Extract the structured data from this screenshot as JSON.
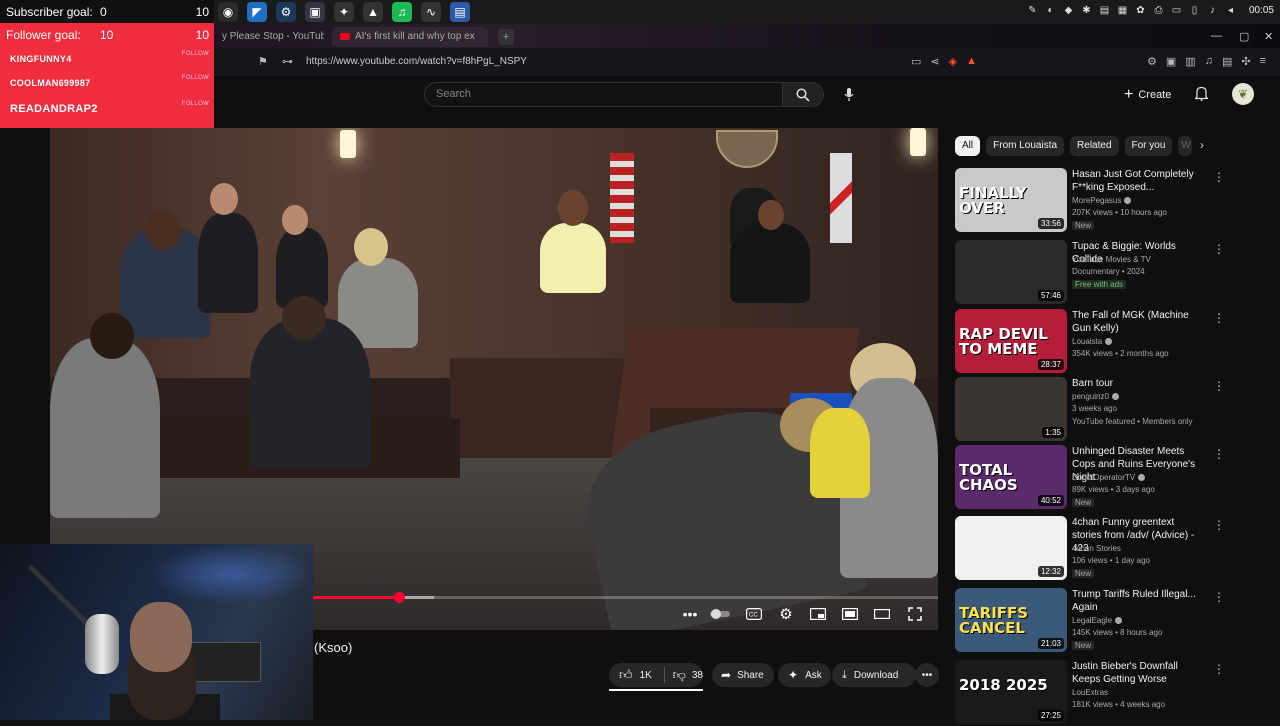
{
  "taskbar": {
    "apps": [
      {
        "icon": "obs-icon",
        "glyph": "◉",
        "color": "#2b2b2b"
      },
      {
        "icon": "vscode-icon",
        "glyph": "◤",
        "color": "#1e6fc4"
      },
      {
        "icon": "steam-icon",
        "glyph": "⚙",
        "color": "#1b3a5a"
      },
      {
        "icon": "remote-desktop-icon",
        "glyph": "▣",
        "color": "#334"
      },
      {
        "icon": "game-controller-icon",
        "glyph": "✦",
        "color": "#333"
      },
      {
        "icon": "upload-icon",
        "glyph": "▲",
        "color": "#333"
      },
      {
        "icon": "spotify-icon",
        "glyph": "♫",
        "color": "#1db954"
      },
      {
        "icon": "monitor-icon",
        "glyph": "∿",
        "color": "#333"
      },
      {
        "icon": "document-icon",
        "glyph": "▤",
        "color": "#2a5aa8"
      }
    ],
    "clock": "00:05"
  },
  "browser": {
    "tabs": [
      {
        "title": "y Please Stop - YouTub"
      },
      {
        "title": "AI's first kill and why top ex"
      }
    ],
    "url": "https://www.youtube.com/watch?v=f8hPgL_NSPY"
  },
  "youtube": {
    "search_placeholder": "Search",
    "create_label": "Create",
    "video_title_fragment": "(Ksoo)",
    "actions": {
      "likes": "1K",
      "dislikes": "38",
      "share": "Share",
      "ask": "Ask",
      "download": "Download"
    },
    "playback": {
      "progress_fraction": 0.393,
      "buffered_fraction": 0.433
    },
    "chips": [
      "All",
      "From Louaista",
      "Related",
      "For you",
      "W"
    ],
    "recommendations": [
      {
        "title": "Hasan Just Got Completely F**king Exposed...",
        "channel": "MorePegasus",
        "verified": true,
        "meta": "207K views • 10 hours ago",
        "badge": "New",
        "extra": "",
        "duration": "33:56",
        "thumb_text": "FINALLY OVER",
        "thumb_color": "#c9c9c9"
      },
      {
        "title": "Tupac & Biggie: Worlds Collide",
        "channel": "YouTube Movies & TV",
        "verified": false,
        "meta": "Documentary • 2024",
        "badge": "",
        "extra": "Free with ads",
        "duration": "57:46",
        "thumb_text": "",
        "thumb_color": "#2a2a2a"
      },
      {
        "title": "The Fall of MGK (Machine Gun Kelly)",
        "channel": "Louaista",
        "verified": true,
        "meta": "354K views • 2 months ago",
        "badge": "",
        "extra": "",
        "duration": "28:37",
        "thumb_text": "RAP DEVIL TO MEME",
        "thumb_color": "#b51e3a"
      },
      {
        "title": "Barn tour",
        "channel": "penguinz0",
        "verified": true,
        "meta": "3 weeks ago",
        "badge": "",
        "extra": "YouTube featured • Members only",
        "duration": "1:35",
        "thumb_text": "",
        "thumb_color": "#3a3530"
      },
      {
        "title": "Unhinged Disaster Meets Cops and Ruins Everyone's Night",
        "channel": "DonutOperatorTV",
        "verified": true,
        "meta": "89K views • 3 days ago",
        "badge": "New",
        "extra": "",
        "duration": "40:52",
        "thumb_text": "TOTAL CHAOS",
        "thumb_color": "#5a2a6a"
      },
      {
        "title": "4chan Funny greentext stories from /adv/ (Advice) - 423",
        "channel": "4chan Stories",
        "verified": false,
        "meta": "106 views • 1 day ago",
        "badge": "New",
        "extra": "",
        "duration": "12:32",
        "thumb_text": "",
        "thumb_color": "#f0f0f0"
      },
      {
        "title": "Trump Tariffs Ruled Illegal... Again",
        "channel": "LegalEagle",
        "verified": true,
        "meta": "145K views • 8 hours ago",
        "badge": "New",
        "extra": "",
        "duration": "21:03",
        "thumb_text": "TARIFFS CANCEL",
        "thumb_color": "#3b5a7a"
      },
      {
        "title": "Justin Bieber's Downfall Keeps Getting Worse",
        "channel": "LouExtras",
        "verified": false,
        "meta": "181K views • 4 weeks ago",
        "badge": "",
        "extra": "",
        "duration": "27:25",
        "thumb_text": "2018 2025",
        "thumb_color": "#1a1a1a"
      }
    ]
  },
  "stream_overlay": {
    "subscriber_label": "Subscriber goal:",
    "subscriber_current": "0",
    "subscriber_target": "10",
    "follower_label": "Follower goal:",
    "follower_current": "10",
    "follower_target": "10",
    "follow_alerts": [
      {
        "name": "KINGFUNNY4",
        "tag": "FOLLOW"
      },
      {
        "name": "COOLMAN699987",
        "tag": "FOLLOW"
      },
      {
        "name": "READANDRAP2",
        "tag": "FOLLOW"
      }
    ]
  },
  "colors": {
    "accent": "#ff0033",
    "overlay_red": "#ef2d3e",
    "bg": "#0f0f0f"
  }
}
